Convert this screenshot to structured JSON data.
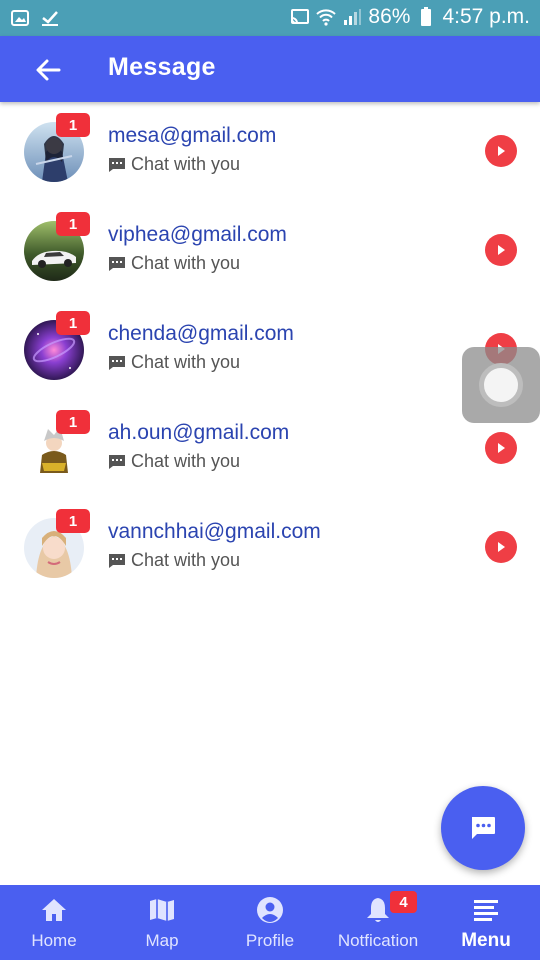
{
  "status_bar": {
    "battery": "86%",
    "time": "4:57 p.m.",
    "icons": [
      "gallery-icon",
      "check-icon",
      "cast-icon",
      "wifi-icon",
      "signal-icon",
      "battery-icon"
    ]
  },
  "app_bar": {
    "title": "Message",
    "back_icon": "arrow-left-icon"
  },
  "messages": [
    {
      "email": "mesa@gmail.com",
      "subtitle": "Chat with you",
      "unread": "1"
    },
    {
      "email": "viphea@gmail.com",
      "subtitle": "Chat with you",
      "unread": "1"
    },
    {
      "email": "chenda@gmail.com",
      "subtitle": "Chat with you",
      "unread": "1"
    },
    {
      "email": "ah.oun@gmail.com",
      "subtitle": "Chat with you",
      "unread": "1"
    },
    {
      "email": "vannchhai@gmail.com",
      "subtitle": "Chat with you",
      "unread": "1"
    }
  ],
  "fab": {
    "icon": "chat-bubble-icon"
  },
  "bottom_nav": {
    "items": [
      {
        "label": "Home",
        "icon": "home-icon"
      },
      {
        "label": "Map",
        "icon": "map-icon"
      },
      {
        "label": "Profile",
        "icon": "account-circle-icon"
      },
      {
        "label": "Notfication",
        "icon": "bell-icon",
        "badge": "4"
      },
      {
        "label": "Menu",
        "icon": "menu-icon",
        "active": true
      }
    ]
  },
  "colors": {
    "primary": "#4a5ff0",
    "status_bar": "#4b9fb6",
    "badge": "#f0303a",
    "play": "#ef3e45",
    "email_text": "#2b44b0"
  }
}
